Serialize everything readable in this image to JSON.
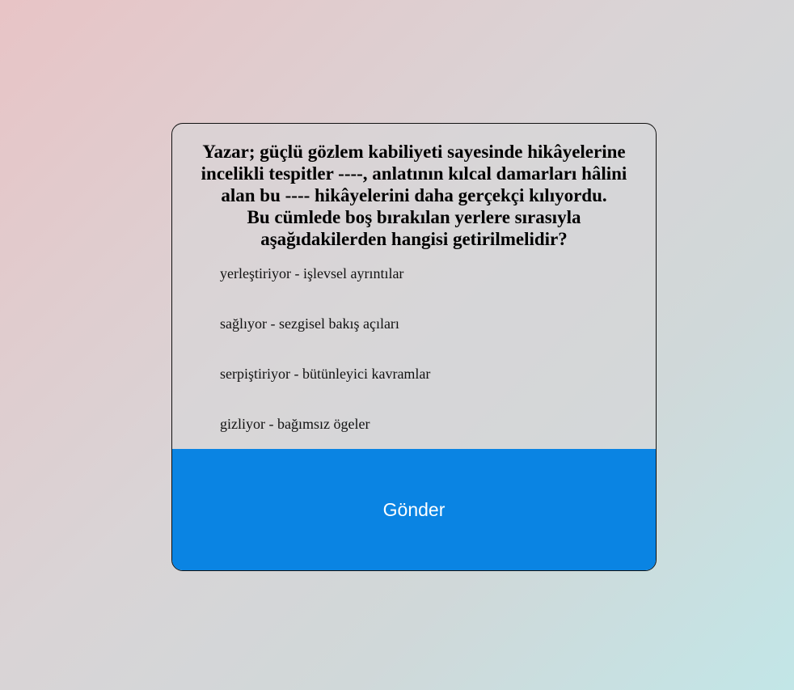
{
  "question": {
    "lines": [
      "Yazar; güçlü gözlem kabiliyeti sayesinde hikâyelerine",
      "incelikli tespitler ----, anlatının kılcal damarları hâlini",
      "alan bu ---- hikâyelerini daha gerçekçi kılıyordu.",
      "Bu cümlede boş bırakılan yerlere sırasıyla",
      "aşağıdakilerden hangisi getirilmelidir?"
    ]
  },
  "options": [
    "yerleştiriyor - işlevsel ayrıntılar",
    "sağlıyor - sezgisel bakış açıları",
    "serpiştiriyor - bütünleyici kavramlar",
    "gizliyor - bağımsız ögeler"
  ],
  "submit": {
    "label": "Gönder",
    "color": "#0a84e3"
  }
}
